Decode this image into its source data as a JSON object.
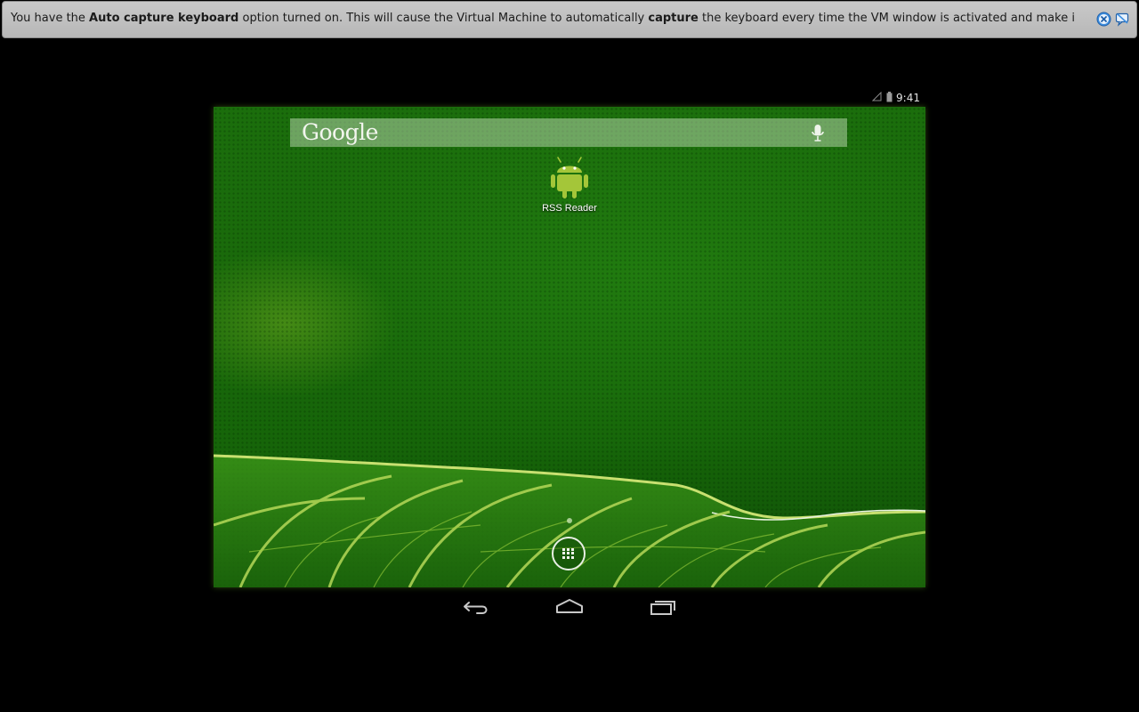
{
  "notification": {
    "text_1": "You have the ",
    "bold_1": "Auto capture keyboard",
    "text_2": " option turned on. This will cause the Virtual Machine to automatically ",
    "bold_2": "capture",
    "text_3": " the keyboard every time the VM window is activated and make it unavailable to other",
    "close_icon": "close-circle-icon",
    "suppress_icon": "do-not-show-again-icon"
  },
  "android": {
    "status_bar": {
      "time": "9:41",
      "signal_icon": "signal-icon",
      "battery_icon": "battery-icon"
    },
    "search_bar": {
      "logo": "Google",
      "mic_icon": "microphone-icon"
    },
    "app": {
      "label": "RSS Reader",
      "icon": "android-icon"
    },
    "all_apps_icon": "all-apps-icon",
    "nav": {
      "back_icon": "back-icon",
      "home_icon": "home-icon",
      "recents_icon": "recents-icon"
    },
    "colors": {
      "wallpaper": "#1a6a0b",
      "android_green": "#a4c639"
    }
  }
}
